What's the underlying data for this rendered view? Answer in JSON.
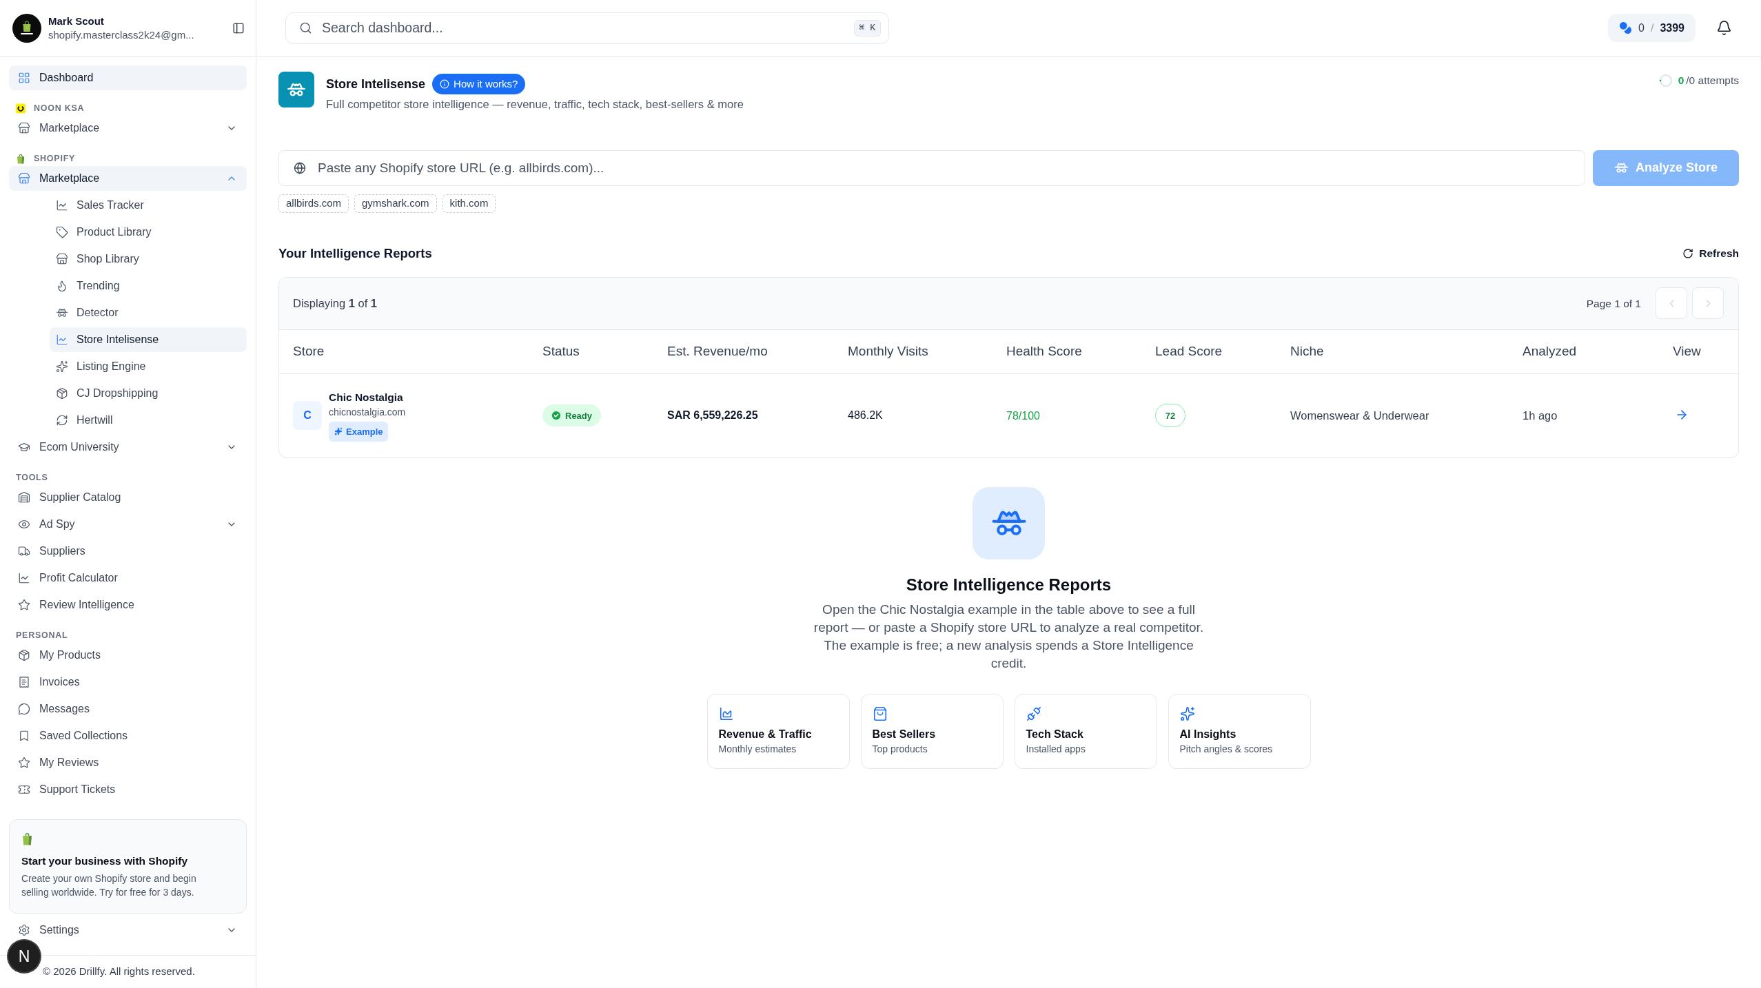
{
  "user": {
    "name": "Mark Scout",
    "email": "shopify.masterclass2k24@gm..."
  },
  "sidebar": {
    "sections": [
      {
        "items": [
          {
            "label": "Dashboard",
            "selected": true
          }
        ]
      },
      {
        "title": "NOON KSA",
        "items": [
          {
            "label": "Marketplace",
            "selected": false,
            "expanded": false
          }
        ]
      },
      {
        "title": "SHOPIFY",
        "items": [
          {
            "label": "Marketplace",
            "selected": true,
            "expanded": true,
            "children": [
              {
                "label": "Sales Tracker",
                "selected": false
              },
              {
                "label": "Product Library",
                "selected": false
              },
              {
                "label": "Shop Library",
                "selected": false
              },
              {
                "label": "Trending",
                "selected": false
              },
              {
                "label": "Detector",
                "selected": false
              },
              {
                "label": "Store Intelisense",
                "selected": true
              },
              {
                "label": "Listing Engine",
                "selected": false
              },
              {
                "label": "CJ Dropshipping",
                "selected": false
              },
              {
                "label": "Hertwill",
                "selected": false
              }
            ]
          },
          {
            "label": "Ecom University",
            "selected": false,
            "expanded": false
          }
        ]
      },
      {
        "title": "TOOLS",
        "items": [
          {
            "label": "Supplier Catalog",
            "selected": false
          },
          {
            "label": "Ad Spy",
            "selected": false,
            "expanded": false
          },
          {
            "label": "Suppliers",
            "selected": false
          },
          {
            "label": "Profit Calculator",
            "selected": false
          },
          {
            "label": "Review Intelligence",
            "selected": false
          }
        ]
      },
      {
        "title": "PERSONAL",
        "items": [
          {
            "label": "My Products",
            "selected": false
          },
          {
            "label": "Invoices",
            "selected": false
          },
          {
            "label": "Messages",
            "selected": false
          },
          {
            "label": "Saved Collections",
            "selected": false
          },
          {
            "label": "My Reviews",
            "selected": false
          },
          {
            "label": "Support Tickets",
            "selected": false
          }
        ]
      }
    ],
    "promo": {
      "title": "Start your business with Shopify",
      "text": "Create your own Shopify store and begin selling worldwide. Try for free for 3 days."
    },
    "settings": {
      "label": "Settings",
      "expanded": false
    },
    "copyright": "© 2026 Drillfy. All rights reserved."
  },
  "dev_badge": "N",
  "header": {
    "search": {
      "placeholder": "Search dashboard...",
      "shortcut": "⌘ K"
    },
    "credits": {
      "used": "0",
      "separator": "/",
      "total": "3399"
    }
  },
  "page": {
    "title": "Store Intelisense",
    "help_button": "How it works?",
    "subtitle": "Full competitor store intelligence — revenue, traffic, tech stack, best-sellers & more",
    "attempts": {
      "level": 0,
      "used": "0",
      "separator": "/",
      "total": "0",
      "label": "attempts"
    },
    "url_input": {
      "placeholder": "Paste any Shopify store URL (e.g. allbirds.com)..."
    },
    "analyze_button": {
      "label": "Analyze Store",
      "disabled": true
    },
    "suggestions": [
      "allbirds.com",
      "gymshark.com",
      "kith.com"
    ]
  },
  "reports": {
    "title": "Your Intelligence Reports",
    "refresh": "Refresh",
    "displaying": "Displaying **1** of **1**",
    "pagination": {
      "label": "Page 1 of 1",
      "prev_disabled": true,
      "next_disabled": true
    },
    "columns": [
      "Store",
      "Status",
      "Est. Revenue/mo",
      "Monthly Visits",
      "Health Score",
      "Lead Score",
      "Niche",
      "Analyzed",
      "View"
    ],
    "rows": [
      {
        "initial": "C",
        "name": "Chic Nostalgia",
        "domain": "chicnostalgia.com",
        "badge": "Example",
        "status": {
          "label": "Ready",
          "kind": "ready"
        },
        "revenue": "SAR 6,559,226.25",
        "visits": "486.2K",
        "health": "78/100",
        "lead": "72",
        "niche": "Womenswear & Underwear",
        "analyzed": "1h ago"
      }
    ]
  },
  "empty_state": {
    "title": "Store Intelligence Reports",
    "text": "Open the Chic Nostalgia example in the table above to see a full report — or paste a Shopify store URL to analyze a real competitor. The example is free; a new analysis spends a Store Intelligence credit.",
    "features": [
      {
        "title": "Revenue & Traffic",
        "subtitle": "Monthly estimates"
      },
      {
        "title": "Best Sellers",
        "subtitle": "Top products"
      },
      {
        "title": "Tech Stack",
        "subtitle": "Installed apps"
      },
      {
        "title": "AI Insights",
        "subtitle": "Pitch angles & scores"
      }
    ]
  }
}
